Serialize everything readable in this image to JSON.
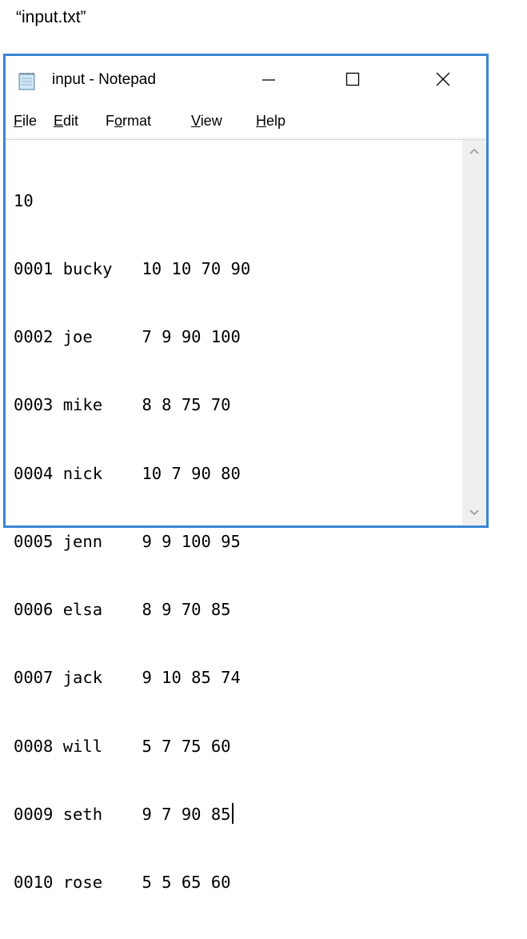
{
  "caption": "“input.txt”",
  "window": {
    "title": "input - Notepad",
    "app_icon": "notepad-icon",
    "controls": {
      "minimize": "minimize-icon",
      "maximize": "maximize-icon",
      "close": "close-icon"
    }
  },
  "menu": [
    {
      "mnemonic": "F",
      "rest": "ile"
    },
    {
      "mnemonic": "E",
      "rest": "dit"
    },
    {
      "pre": "F",
      "mnemonic": "o",
      "rest": "rmat"
    },
    {
      "mnemonic": "V",
      "rest": "iew"
    },
    {
      "mnemonic": "H",
      "rest": "elp"
    }
  ],
  "document": {
    "lines": [
      "10",
      "0001 bucky   10 10 70 90",
      "0002 joe     7 9 90 100",
      "0003 mike    8 8 75 70",
      "0004 nick    10 7 90 80",
      "0005 jenn    9 9 100 95",
      "0006 elsa    8 9 70 85",
      "0007 jack    9 10 85 74",
      "0008 will    5 7 75 60",
      "0009 seth    9 7 90 85",
      "0010 rose    5 5 65 60"
    ],
    "caret_line_index": 9
  },
  "scrollbar": {
    "up": "chevron-up-icon",
    "down": "chevron-down-icon"
  }
}
